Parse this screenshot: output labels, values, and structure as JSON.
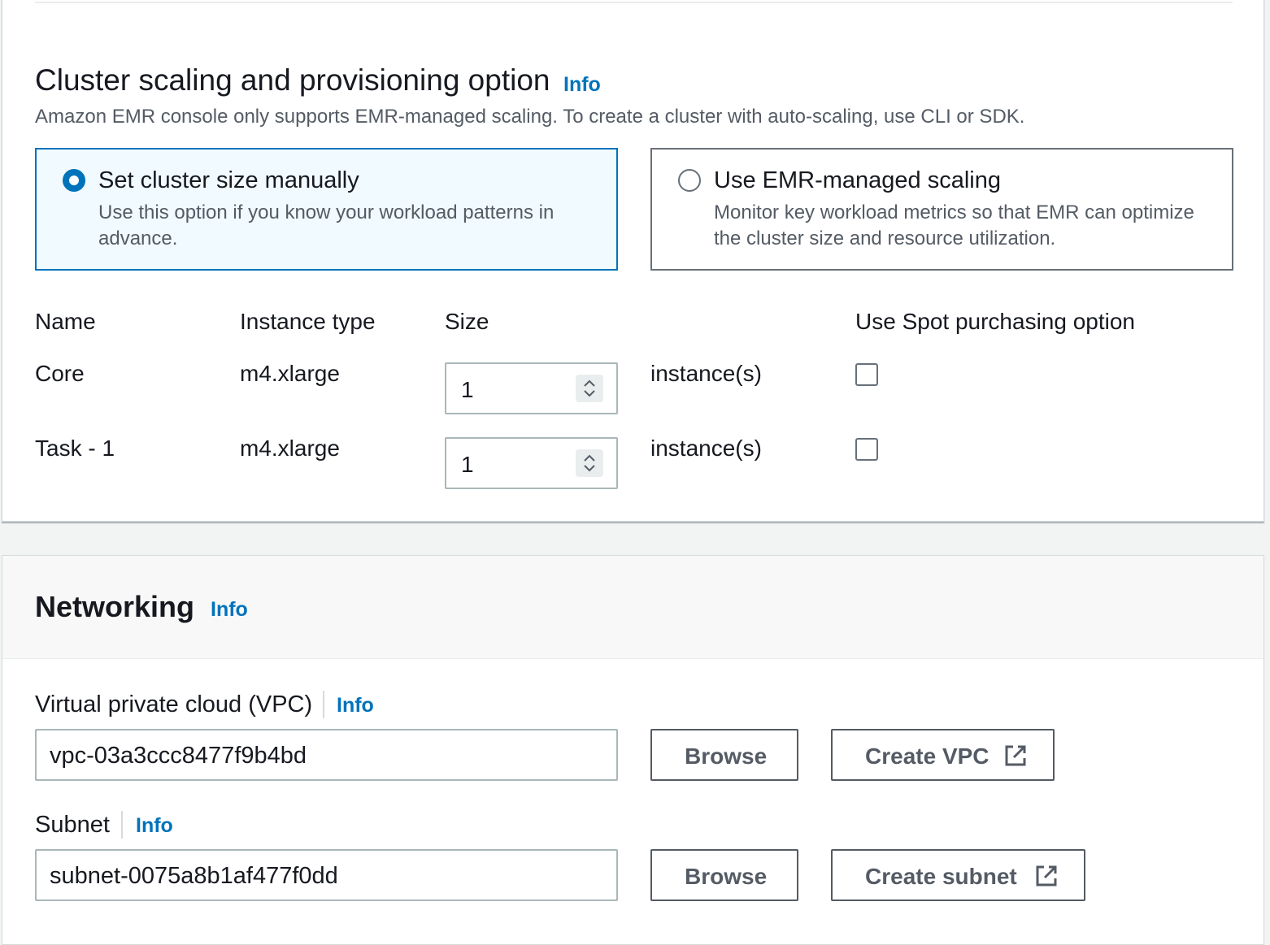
{
  "scaling": {
    "title": "Cluster scaling and provisioning option",
    "info": "Info",
    "description": "Amazon EMR console only supports EMR-managed scaling. To create a cluster with auto-scaling, use CLI or SDK.",
    "options": [
      {
        "label": "Set cluster size manually",
        "description": "Use this option if you know your workload patterns in advance.",
        "selected": true
      },
      {
        "label": "Use EMR-managed scaling",
        "description": "Monitor key workload metrics so that EMR can optimize the cluster size and resource utilization.",
        "selected": false
      }
    ],
    "columns": {
      "name": "Name",
      "instance_type": "Instance type",
      "size": "Size",
      "spot": "Use Spot purchasing option"
    },
    "rows": [
      {
        "name": "Core",
        "instance_type": "m4.xlarge",
        "size": "1",
        "unit": "instance(s)",
        "spot": false
      },
      {
        "name": "Task - 1",
        "instance_type": "m4.xlarge",
        "size": "1",
        "unit": "instance(s)",
        "spot": false
      }
    ]
  },
  "networking": {
    "title": "Networking",
    "info": "Info",
    "vpc": {
      "label": "Virtual private cloud (VPC)",
      "info": "Info",
      "value": "vpc-03a3ccc8477f9b4bd",
      "browse": "Browse",
      "create": "Create VPC"
    },
    "subnet": {
      "label": "Subnet",
      "info": "Info",
      "value": "subnet-0075a8b1af477f0dd",
      "browse": "Browse",
      "create": "Create subnet"
    }
  },
  "colors": {
    "accent": "#0073bb",
    "selected_tile_bg": "#f1faff",
    "text": "#16191f",
    "secondary_text": "#545b64"
  },
  "icons": [
    "radio-selected-icon",
    "radio-unselected-icon",
    "spinner-icon",
    "checkbox-icon",
    "external-link-icon"
  ]
}
